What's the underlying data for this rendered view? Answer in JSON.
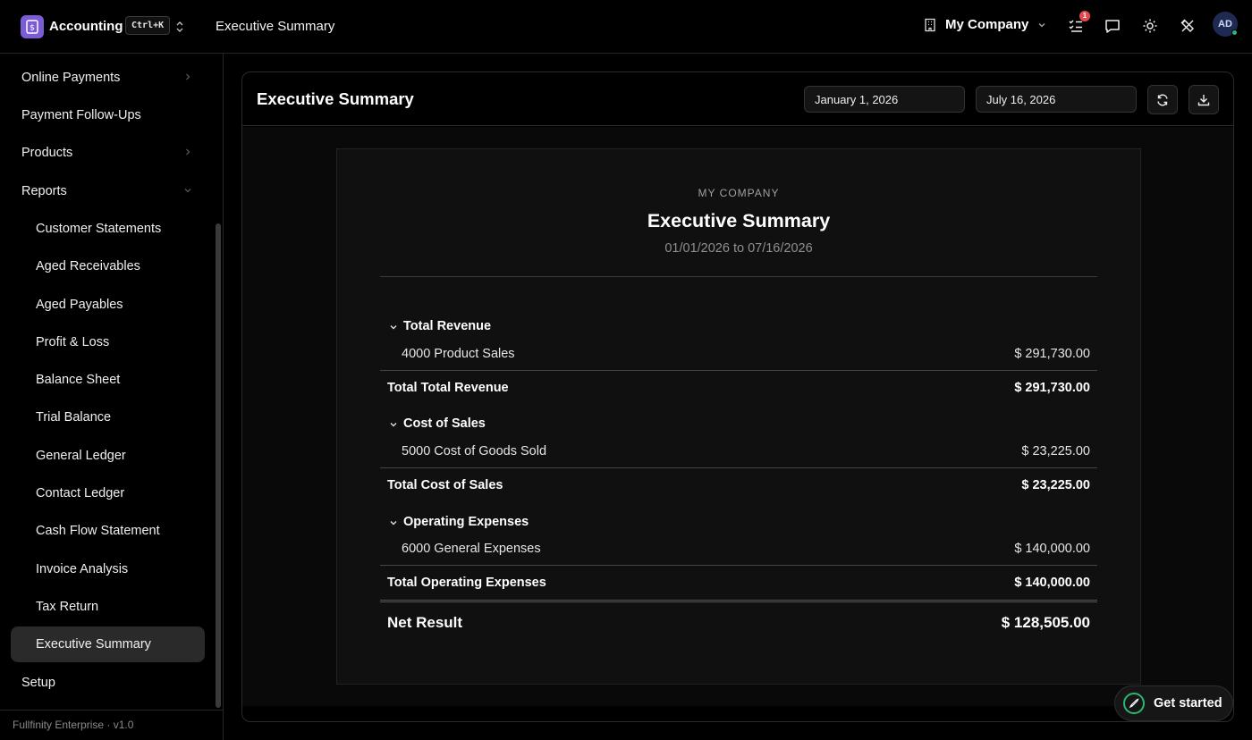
{
  "app": {
    "name": "Accounting",
    "shortcut": "Ctrl+K",
    "breadcrumb": "Executive Summary",
    "company": "My Company",
    "notification_count": "1",
    "avatar_initials": "AD"
  },
  "sidebar": {
    "items": [
      {
        "label": "Online Payments",
        "chevron": "right"
      },
      {
        "label": "Payment Follow-Ups"
      },
      {
        "label": "Products",
        "chevron": "right"
      },
      {
        "label": "Reports",
        "chevron": "down"
      },
      {
        "label": "Customer Statements"
      },
      {
        "label": "Aged Receivables"
      },
      {
        "label": "Aged Payables"
      },
      {
        "label": "Profit & Loss"
      },
      {
        "label": "Balance Sheet"
      },
      {
        "label": "Trial Balance"
      },
      {
        "label": "General Ledger"
      },
      {
        "label": "Contact Ledger"
      },
      {
        "label": "Cash Flow Statement"
      },
      {
        "label": "Invoice Analysis"
      },
      {
        "label": "Tax Return"
      },
      {
        "label": "Executive Summary",
        "active": true
      },
      {
        "label": "Setup"
      }
    ],
    "footer": "Fullfinity Enterprise · v1.0"
  },
  "card": {
    "title": "Executive Summary",
    "start_date": "January 1, 2026",
    "end_date": "July 16, 2026"
  },
  "report": {
    "company": "MY COMPANY",
    "title": "Executive Summary",
    "range": "01/01/2026 to 07/16/2026",
    "sections": [
      {
        "title": "Total Revenue",
        "line_label": "4000 Product Sales",
        "line_amount": "$ 291,730.00",
        "total_label": "Total Total Revenue",
        "total_amount": "$ 291,730.00"
      },
      {
        "title": "Cost of Sales",
        "line_label": "5000 Cost of Goods Sold",
        "line_amount": "$ 23,225.00",
        "total_label": "Total Cost of Sales",
        "total_amount": "$ 23,225.00"
      },
      {
        "title": "Operating Expenses",
        "line_label": "6000 General Expenses",
        "line_amount": "$ 140,000.00",
        "total_label": "Total Operating Expenses",
        "total_amount": "$ 140,000.00"
      }
    ],
    "net_label": "Net Result",
    "net_amount": "$ 128,505.00"
  },
  "get_started": "Get started",
  "colors": {
    "accent": "#7b5cd6",
    "badge": "#e5484d",
    "online": "#2bb673"
  }
}
